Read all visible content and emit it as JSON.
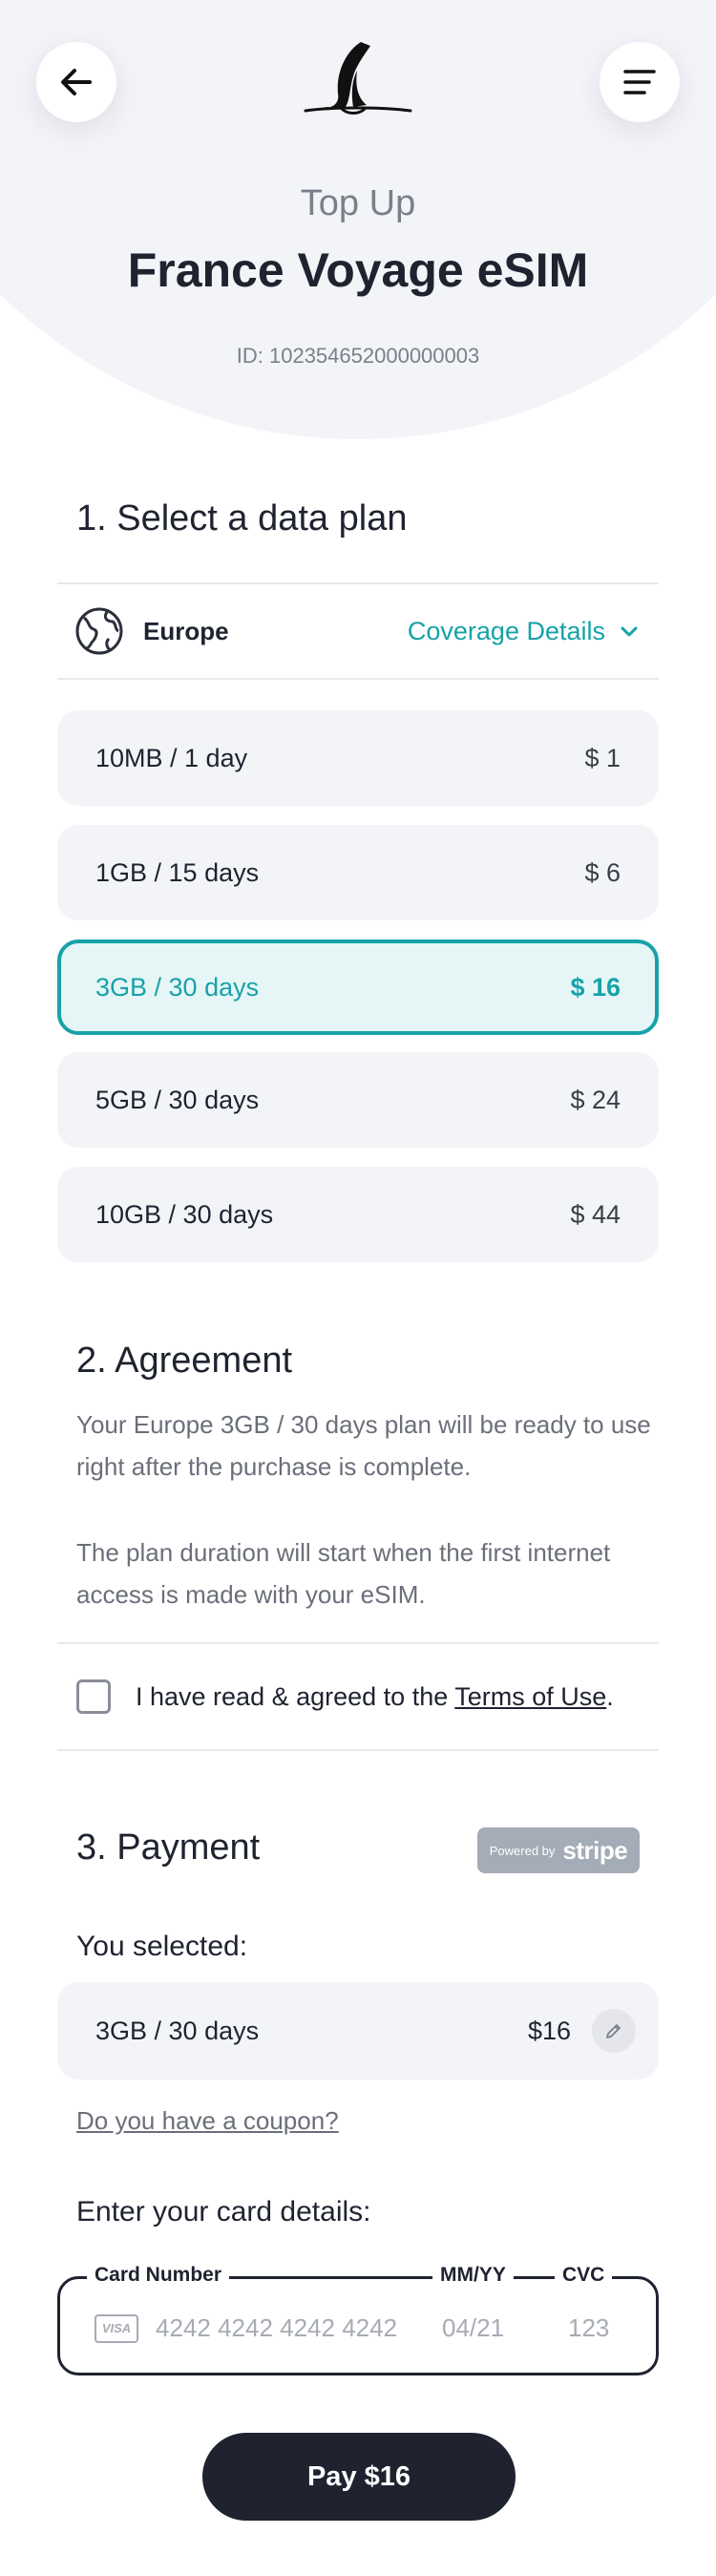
{
  "header": {
    "subtitle": "Top Up",
    "title": "France Voyage eSIM",
    "id_text": "ID: 102354652000000003"
  },
  "plans_section": {
    "title": "1. Select a data plan",
    "region": "Europe",
    "coverage_link": "Coverage Details",
    "plans": [
      {
        "name": "10MB / 1 day",
        "price": "$ 1"
      },
      {
        "name": "1GB / 15 days",
        "price": "$ 6"
      },
      {
        "name": "3GB / 30 days",
        "price": "$ 16"
      },
      {
        "name": "5GB / 30 days",
        "price": "$ 24"
      },
      {
        "name": "10GB / 30 days",
        "price": "$ 44"
      }
    ],
    "selected_index": 2
  },
  "agreement": {
    "title": "2. Agreement",
    "paragraph1": "Your Europe 3GB / 30 days plan will be ready to use right after the purchase is complete.",
    "paragraph2": "The plan duration will start when the first internet access is made with your eSIM.",
    "checkbox_prefix": "I have read & agreed to the ",
    "terms_link": "Terms of Use",
    "checkbox_suffix": "."
  },
  "payment": {
    "title": "3. Payment",
    "stripe_powered": "Powered by",
    "stripe_brand": "stripe",
    "you_selected_label": "You selected:",
    "selected_plan": "3GB / 30 days",
    "selected_price": "$16",
    "coupon_link": "Do you have a coupon?",
    "card_label": "Enter your card details:",
    "card_number_label": "Card Number",
    "expiry_label": "MM/YY",
    "cvc_label": "CVC",
    "card_number_placeholder": "4242 4242 4242 4242",
    "expiry_placeholder": "04/21",
    "cvc_placeholder": "123",
    "card_brand_text": "VISA",
    "pay_button": "Pay $16"
  },
  "colors": {
    "accent": "#17a2a8",
    "dark": "#1f2330",
    "panel": "#f3f4f8"
  }
}
